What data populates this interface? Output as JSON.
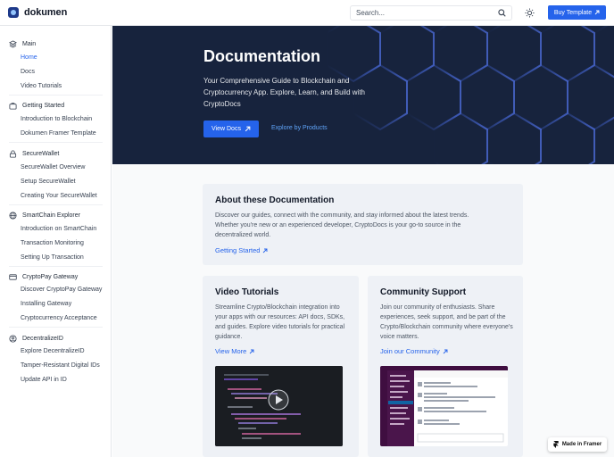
{
  "header": {
    "brand": "dokumen",
    "search_placeholder": "Search...",
    "buy_label": "Buy Template"
  },
  "sidebar": {
    "sections": [
      {
        "title": "Main",
        "icon": "layers-icon",
        "items": [
          "Home",
          "Docs",
          "Video Tutorials"
        ]
      },
      {
        "title": "Getting Started",
        "icon": "briefcase-icon",
        "items": [
          "Introduction to Blockchain",
          "Dokumen Framer Template"
        ]
      },
      {
        "title": "SecureWallet",
        "icon": "lock-icon",
        "items": [
          "SecureWallet Overview",
          "Setup SecureWallet",
          "Creating Your SecureWallet"
        ]
      },
      {
        "title": "SmartChain Explorer",
        "icon": "globe-icon",
        "items": [
          "Introduction on SmartChain",
          "Transaction Monitoring",
          "Setting Up Transaction"
        ]
      },
      {
        "title": "CryptoPay Gateway",
        "icon": "credit-card-icon",
        "items": [
          "Discover CryptoPay Gateway",
          "Installing Gateway",
          "Cryptocurrency Acceptance"
        ]
      },
      {
        "title": "DecentralizeID",
        "icon": "user-circle-icon",
        "items": [
          "Explore DecentralizeID",
          "Tamper-Resistant Digital IDs",
          "Update API in ID"
        ]
      }
    ]
  },
  "hero": {
    "title": "Documentation",
    "subtitle": "Your Comprehensive Guide to Blockchain and Cryptocurrency App. Explore, Learn, and Build with CryptoDocs",
    "primary_button": "View Docs",
    "secondary_link": "Explore by Products"
  },
  "about": {
    "title": "About these Documentation",
    "text": "Discover our guides, connect with the community, and stay informed about the latest trends. Whether you're new or an experienced developer, CryptoDocs is your go-to source in the decentralized world.",
    "link": "Getting Started"
  },
  "video": {
    "title": "Video Tutorials",
    "text": "Streamline Crypto/Blockchain integration into your apps with our resources: API docs, SDKs, and guides. Explore video tutorials for practical guidance.",
    "link": "View More"
  },
  "community": {
    "title": "Community Support",
    "text": "Join our community of enthusiasts. Share experiences, seek support, and be part of the Crypto/Blockchain community where everyone's voice matters.",
    "link": "Join our Community"
  },
  "badge": {
    "label": "Made in Framer"
  },
  "colors": {
    "accent": "#2563eb",
    "hero_bg": "#17233d",
    "card_bg": "#eef1f6"
  }
}
